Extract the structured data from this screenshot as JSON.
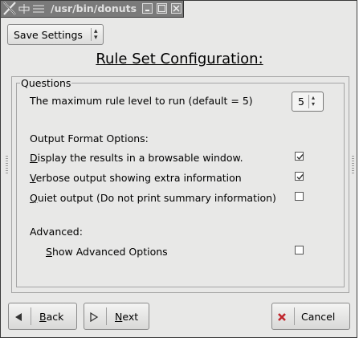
{
  "window": {
    "title": "/usr/bin/donuts"
  },
  "toolbar": {
    "settings_combo_label": "Save Settings"
  },
  "dialog": {
    "heading": "Rule Set Configuration:",
    "questions_legend": "Questions",
    "max_rule_level_label": "The maximum rule level to run (default = 5)",
    "max_rule_level_value": "5",
    "output_format_label": "Output Format Options:",
    "options": [
      {
        "label": "Display the results in a browsable window.",
        "checked": true
      },
      {
        "label": "Verbose output showing extra information",
        "checked": true
      },
      {
        "label": "Quiet output (Do not print summary information)",
        "checked": false
      }
    ],
    "advanced_label": "Advanced:",
    "show_advanced": {
      "label": "Show Advanced Options",
      "checked": false
    }
  },
  "buttons": {
    "back": "Back",
    "next": "Next",
    "cancel": "Cancel"
  },
  "colors": {
    "titlebar": "#7a7a7a",
    "window_bg": "#e8e8e7",
    "cancel_icon": "#c0262c"
  },
  "icons": {
    "back": "arrow-left-icon",
    "next": "arrow-right-icon",
    "cancel": "cancel-x-icon"
  }
}
